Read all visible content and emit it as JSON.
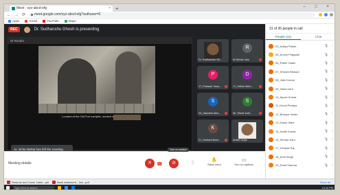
{
  "browser": {
    "tab_title": "Meet - xyz-abcd-efg",
    "tab_close": "×",
    "new_tab": "+",
    "window_controls": "–  □  ×",
    "url": "meet.google.com/xyz-abcd-efg?authuser=0",
    "nav": {
      "back": "←",
      "forward": "→",
      "reload": "⟳"
    },
    "bookmarks": [
      {
        "label": "Apps",
        "color": "#4285f4"
      },
      {
        "label": "Gmail",
        "color": "#ea4335"
      },
      {
        "label": "YouTube",
        "color": "#ff0000"
      },
      {
        "label": "Maps",
        "color": "#34a853"
      }
    ]
  },
  "meet": {
    "rec_label": "REC",
    "presenting_text": "Dr. Sudhanshu Ghosh is presenting",
    "presentation_window_title": "W Reader",
    "photo_caption": "Located at the Old Fort complex, ancient stone arch ruins",
    "toast": "Ar. Ishita Mehta has left the meeting",
    "tiles": [
      {
        "name": "Dr. Sudhanshu Gh...",
        "letter": "",
        "color": "",
        "video": "cam1"
      },
      {
        "name": "M.Mohan Jain",
        "letter": "R",
        "color": "#5f6368",
        "video": ""
      },
      {
        "name": "17_Prakash Yada...",
        "letter": "P",
        "color": "#e91e63",
        "video": ""
      },
      {
        "name": "17_Hrithik Mehr...",
        "letter": "D",
        "color": "#8e24aa",
        "video": ""
      },
      {
        "name": "20_Saurabh Ahm...",
        "letter": "S",
        "color": "#1565c0",
        "video": ""
      },
      {
        "name": "Mr. Shruti Zadi...",
        "letter": "S",
        "color": "#2e7d32",
        "video": ""
      },
      {
        "name": "21_Srabani Bose...",
        "letter": "K",
        "color": "#6d4c41",
        "video": ""
      },
      {
        "name": "Aniket Gujar",
        "letter": "",
        "color": "",
        "video": "cam2"
      }
    ],
    "controls": {
      "meeting_details": "Meeting details",
      "hangup_icon": "☎",
      "tooltip": "Turn on camera",
      "raise_hand": "Raise hand",
      "turn_on_captions": "Turn on captions",
      "present_now": "Ar. Sudhanshu Ghosh is presenting"
    }
  },
  "panel": {
    "header": "31 of 35 people in call",
    "tab_people": "People (31)",
    "tab_chat": "Chat",
    "people": [
      {
        "name": "03_Aditya Pande",
        "color": "#ef6c00"
      },
      {
        "name": "05_Anmol Prajapati",
        "color": "#f9a825"
      },
      {
        "name": "06_Rahul Yadav",
        "color": "#ef6c00"
      },
      {
        "name": "07_Shivam Bhasan",
        "color": "#ef6c00"
      },
      {
        "name": "08_Jatin Kumar",
        "color": "#f57c00"
      },
      {
        "name": "09_Vikas Kant",
        "color": "#ef6c00"
      },
      {
        "name": "10_Ayush Kumar",
        "color": "#f57c00"
      },
      {
        "name": "11_Kunal Pandya",
        "color": "#e65100"
      },
      {
        "name": "12_Bhavya Yadav",
        "color": "#ef6c00"
      },
      {
        "name": "13_Harsh Saini",
        "color": "#ef6c00"
      },
      {
        "name": "15_Kartik Kumar",
        "color": "#fb8c00"
      },
      {
        "name": "16_Simran Kaur",
        "color": "#ef6c00"
      },
      {
        "name": "17_Deepak Raj",
        "color": "#f57c00"
      },
      {
        "name": "18_Amit Singh",
        "color": "#ef6c00"
      },
      {
        "name": "19_Rohit Sharma",
        "color": "#f57c00"
      }
    ]
  },
  "taskbar": {
    "downloads": [
      "Resume and Cover Letter...pdf",
      "Bank statement - Jan...pdf"
    ],
    "show_all": "Show all",
    "search_placeholder": "Type here to search",
    "clock": "12:10 PM"
  }
}
